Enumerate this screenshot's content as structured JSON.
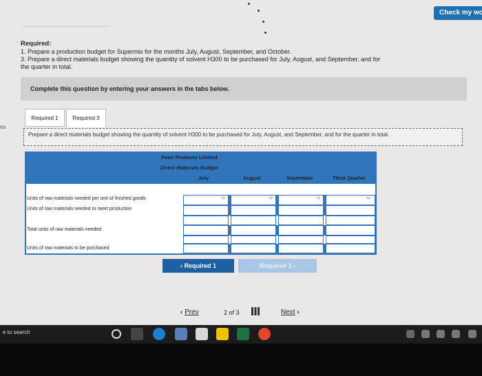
{
  "header": {
    "check_label": "Check my work"
  },
  "required": {
    "heading": "Required:",
    "line1": "1. Prepare a production budget for Supermix for the months July, August, September, and October.",
    "line2": "3. Prepare a direct materials budget showing the quantity of solvent H300 to be purchased for July, August, and September, and for",
    "line3": "the quarter in total."
  },
  "banner": {
    "text": "Complete this question by entering your answers in the tabs below."
  },
  "tabs": [
    {
      "label": "Required 1",
      "active": false
    },
    {
      "label": "Required 3",
      "active": true
    }
  ],
  "side_fragment": "es",
  "instruction": "Prepare a direct materials budget showing the quantity of solvent H300 to be purchased for July, August, and September, and for the quarter in total.",
  "table": {
    "company": "Pearl Products Limited",
    "title": "Direct Materials Budget",
    "columns": [
      "July",
      "August",
      "September",
      "Third Quarter"
    ],
    "rows": [
      {
        "label": "Units of raw materials needed per unit of finished goods",
        "cc": "cc"
      },
      {
        "label": "Units of raw materials needed to meet production"
      },
      {
        "label": "Total units of raw materials needed"
      },
      {
        "label": "Units of raw materials to be purchased"
      }
    ]
  },
  "nav": {
    "prev_req": "Required 1",
    "next_req": "Required 3",
    "prev": "Prev",
    "page": "2 of 3",
    "next": "Next"
  },
  "taskbar": {
    "search": "e to search"
  },
  "colors": {
    "accent": "#2f76bd",
    "button": "#1f6fb3"
  }
}
